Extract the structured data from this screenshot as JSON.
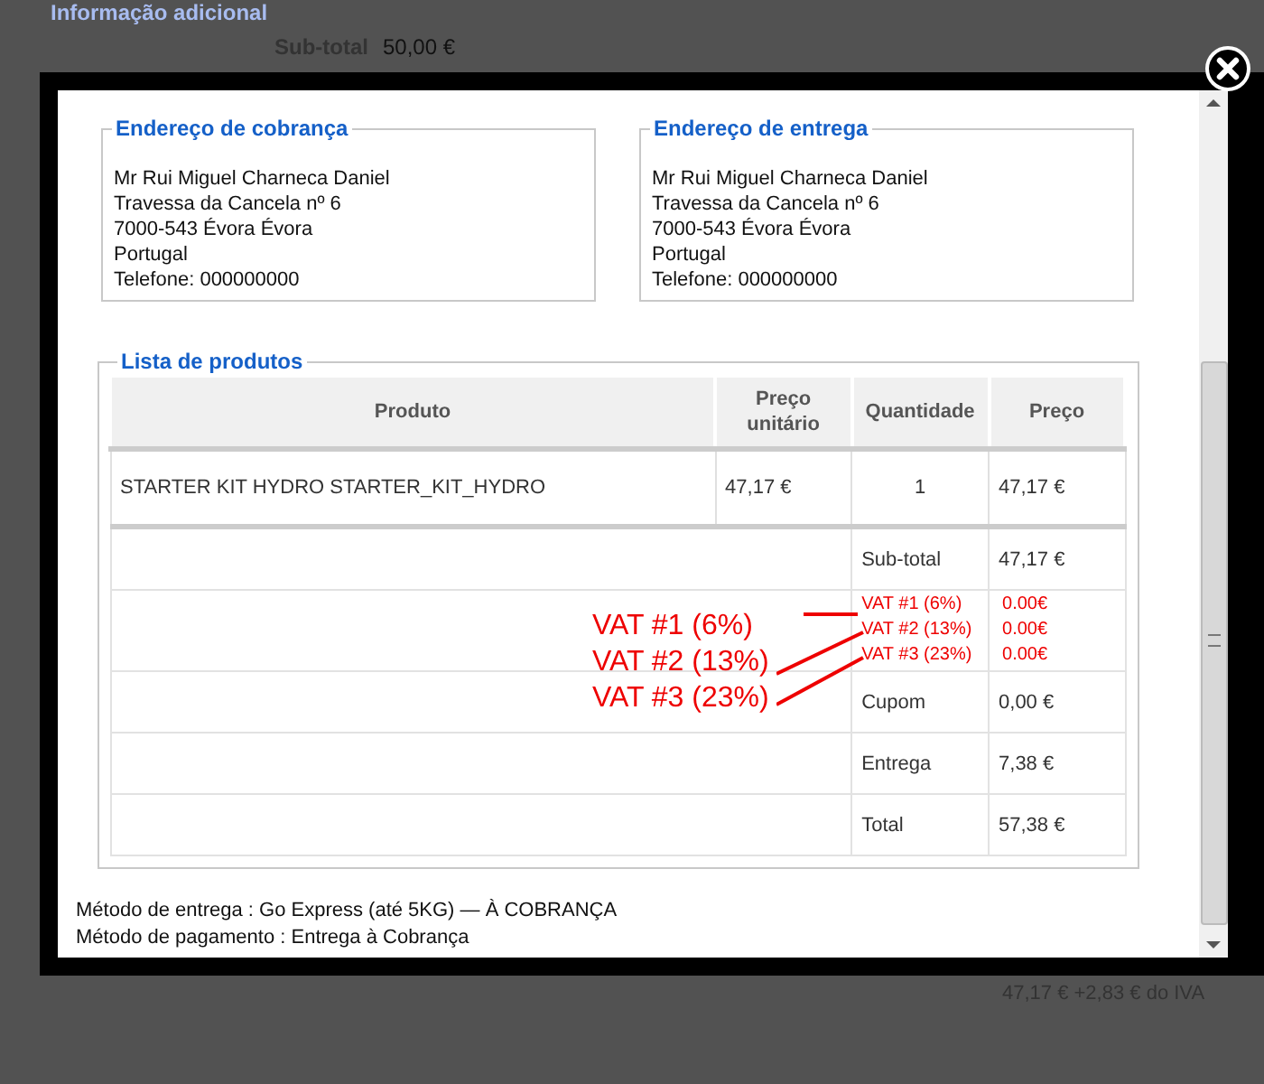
{
  "background": {
    "section_title": "Informação adicional",
    "subtotal_label": "Sub-total",
    "subtotal_value": "50,00 €",
    "tax_note": "47,17 € +2,83 € do IVA"
  },
  "modal": {
    "addresses": [
      {
        "legend": "Endereço de cobrança",
        "lines": [
          "Mr Rui Miguel Charneca Daniel",
          "Travessa da Cancela nº 6",
          "7000-543 Évora Évora",
          "Portugal",
          "Telefone: 000000000"
        ]
      },
      {
        "legend": "Endereço de entrega",
        "lines": [
          "Mr Rui Miguel Charneca Daniel",
          "Travessa da Cancela nº 6",
          "7000-543 Évora Évora",
          "Portugal",
          "Telefone: 000000000"
        ]
      }
    ],
    "products": {
      "legend": "Lista de produtos",
      "columns": [
        "Produto",
        "Preço unitário",
        "Quantidade",
        "Preço"
      ],
      "rows": [
        [
          "STARTER KIT HYDRO STARTER_KIT_HYDRO",
          "47,17 €",
          "1",
          "47,17 €"
        ]
      ],
      "summary": [
        {
          "kind": "plain",
          "label": "Sub-total",
          "value": "47,17 €"
        },
        {
          "kind": "taxes",
          "taxes": [
            {
              "label": "VAT #1 (6%)",
              "value": "0.00€"
            },
            {
              "label": "VAT #2 (13%)",
              "value": "0.00€"
            },
            {
              "label": "VAT #3 (23%)",
              "value": "0.00€"
            }
          ]
        },
        {
          "kind": "plain",
          "label": "Cupom",
          "value": "0,00 €"
        },
        {
          "kind": "plain",
          "label": "Entrega",
          "value": "7,38 €"
        },
        {
          "kind": "plain",
          "label": "Total",
          "value": "57,38 €"
        }
      ]
    },
    "annotations": [
      "VAT #1 (6%)",
      "VAT #2 (13%)",
      "VAT #3 (23%)"
    ],
    "methods": [
      "Método de entrega : Go Express (até 5KG) — À COBRANÇA",
      "Método de pagamento : Entrega à Cobrança"
    ]
  }
}
